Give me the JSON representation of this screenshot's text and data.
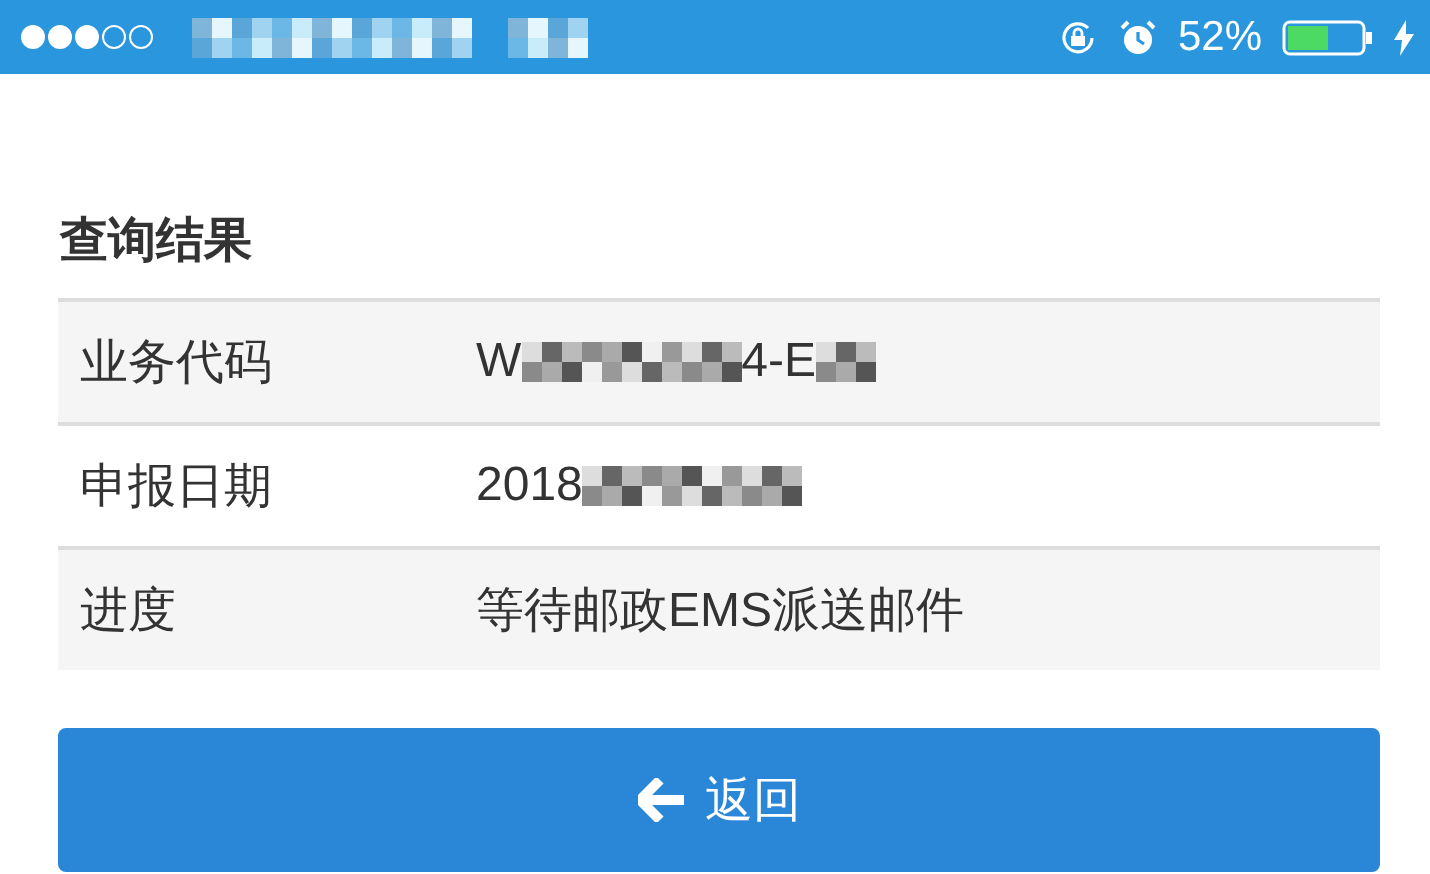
{
  "status_bar": {
    "battery_text": "52%"
  },
  "section_title": "查询结果",
  "rows": [
    {
      "label": "业务代码",
      "value": [
        {
          "kind": "text",
          "text": "W"
        },
        {
          "kind": "redacted"
        },
        {
          "kind": "text",
          "text": "4-E"
        },
        {
          "kind": "redacted"
        }
      ]
    },
    {
      "label": "申报日期",
      "value": [
        {
          "kind": "text",
          "text": "2018"
        },
        {
          "kind": "redacted"
        }
      ]
    },
    {
      "label": "进度",
      "value": [
        {
          "kind": "text",
          "text": "等待邮政EMS派送邮件"
        }
      ]
    }
  ],
  "back_button": {
    "label": "返回"
  }
}
